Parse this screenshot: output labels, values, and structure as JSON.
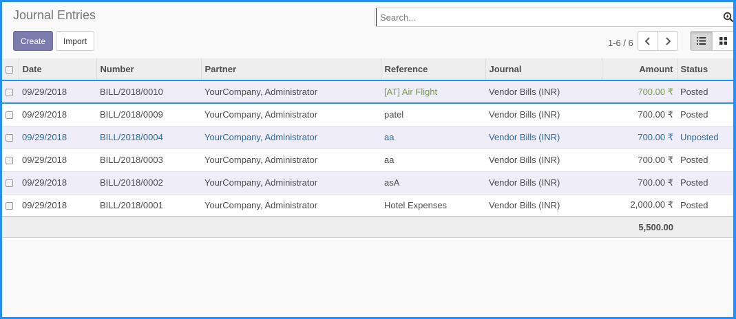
{
  "page": {
    "title": "Journal Entries"
  },
  "search": {
    "placeholder": "Search..."
  },
  "buttons": {
    "create": "Create",
    "import": "Import"
  },
  "pager": {
    "value": "1-6 / 6"
  },
  "table": {
    "columns": [
      "Date",
      "Number",
      "Partner",
      "Reference",
      "Journal",
      "Amount",
      "Status"
    ],
    "rows": [
      [
        "09/29/2018",
        "BILL/2018/0010",
        "YourCompany, Administrator",
        "[AT] Air Flight",
        "Vendor Bills (INR)",
        "700.00 ₹",
        "Posted"
      ],
      [
        "09/29/2018",
        "BILL/2018/0009",
        "YourCompany, Administrator",
        "patel",
        "Vendor Bills (INR)",
        "700.00 ₹",
        "Posted"
      ],
      [
        "09/29/2018",
        "BILL/2018/0004",
        "YourCompany, Administrator",
        "aa",
        "Vendor Bills (INR)",
        "700.00 ₹",
        "Unposted"
      ],
      [
        "09/29/2018",
        "BILL/2018/0003",
        "YourCompany, Administrator",
        "aa",
        "Vendor Bills (INR)",
        "700.00 ₹",
        "Posted"
      ],
      [
        "09/29/2018",
        "BILL/2018/0002",
        "YourCompany, Administrator",
        "asA",
        "Vendor Bills (INR)",
        "700.00 ₹",
        "Posted"
      ],
      [
        "09/29/2018",
        "BILL/2018/0001",
        "YourCompany, Administrator",
        "Hotel Expenses",
        "Vendor Bills (INR)",
        "2,000.00 ₹",
        "Posted"
      ]
    ],
    "total": "5,500.00"
  },
  "colors": {
    "primary": "#7c7bad",
    "highlight": "#cdeeaa",
    "selection": "#1e90ff",
    "draft_text": "#2a6a9d"
  }
}
